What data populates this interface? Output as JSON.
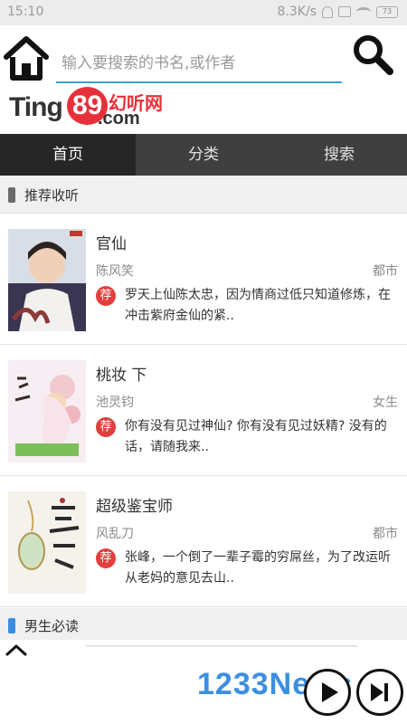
{
  "status_bar": {
    "time": "15:10",
    "network_speed": "8.3K/s",
    "battery": "73"
  },
  "header": {
    "search_placeholder": "输入要搜索的书名,或作者",
    "logo": {
      "ting": "Ting",
      "num": "89",
      "cn": "幻听网",
      "com": ".com"
    }
  },
  "tabs": [
    {
      "label": "首页",
      "active": true
    },
    {
      "label": "分类",
      "active": false
    },
    {
      "label": "搜索",
      "active": false
    }
  ],
  "sections": [
    {
      "title": "推荐收听",
      "color": "#6b6b6b"
    },
    {
      "title": "男生必读",
      "color": "#3a8ee0"
    }
  ],
  "books": [
    {
      "title": "官仙",
      "author": "陈风笑",
      "genre": "都市",
      "tag": "荐",
      "desc": "罗天上仙陈太忠，因为情商过低只知道修炼，在冲击紫府金仙的紧.."
    },
    {
      "title": "桃妆 下",
      "author": "池灵钧",
      "genre": "女生",
      "tag": "荐",
      "desc": "你有没有见过神仙? 你有没有见过妖精? 没有的话，请随我来.."
    },
    {
      "title": "超级鉴宝师",
      "author": "风乱刀",
      "genre": "都市",
      "tag": "荐",
      "desc": "张峰，一个倒了一辈子霉的穷屌丝，为了改运听从老妈的意见去山.."
    }
  ],
  "player": {
    "watermark": "1233News"
  },
  "colors": {
    "accent_blue": "#3aa0d8",
    "tag_red": "#e33e3e",
    "tab_bg": "#3f3f3f",
    "tab_active_bg": "#262626"
  }
}
